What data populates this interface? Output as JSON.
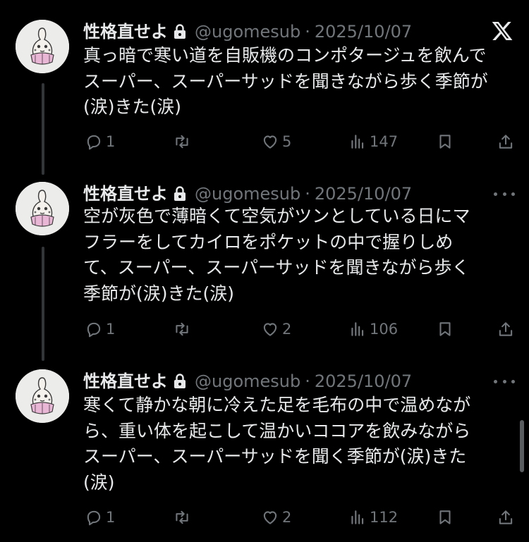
{
  "colors": {
    "background": "#000000",
    "text": "#e7e9ea",
    "muted": "#71767b",
    "thread_line": "#333639"
  },
  "platform_icon": "x-logo-icon",
  "tweets": [
    {
      "name": "性格直せよ",
      "handle": "@ugomesub",
      "separator": "·",
      "date": "2025/10/07",
      "text": "真っ暗で寒い道を自販機のコンポタージュを飲んで\nスーパー、スーパーサッドを聞きながら歩く季節が\n(涙)きた(涙)",
      "replies": "1",
      "retweets": "",
      "likes": "5",
      "views": "147"
    },
    {
      "name": "性格直せよ",
      "handle": "@ugomesub",
      "separator": "·",
      "date": "2025/10/07",
      "text": "空が灰色で薄暗くて空気がツンとしている日にマ\nフラーをしてカイロをポケットの中で握りしめ\nて、スーパー、スーパーサッドを聞きながら歩く\n季節が(涙)きた(涙)",
      "replies": "1",
      "retweets": "",
      "likes": "2",
      "views": "106"
    },
    {
      "name": "性格直せよ",
      "handle": "@ugomesub",
      "separator": "·",
      "date": "2025/10/07",
      "text": "寒くて静かな朝に冷えた足を毛布の中で温めなが\nら、重い体を起こして温かいココアを飲みながら\nスーパー、スーパーサッドを聞く季節が(涙)きた\n(涙)",
      "replies": "1",
      "retweets": "",
      "likes": "2",
      "views": "112"
    }
  ]
}
